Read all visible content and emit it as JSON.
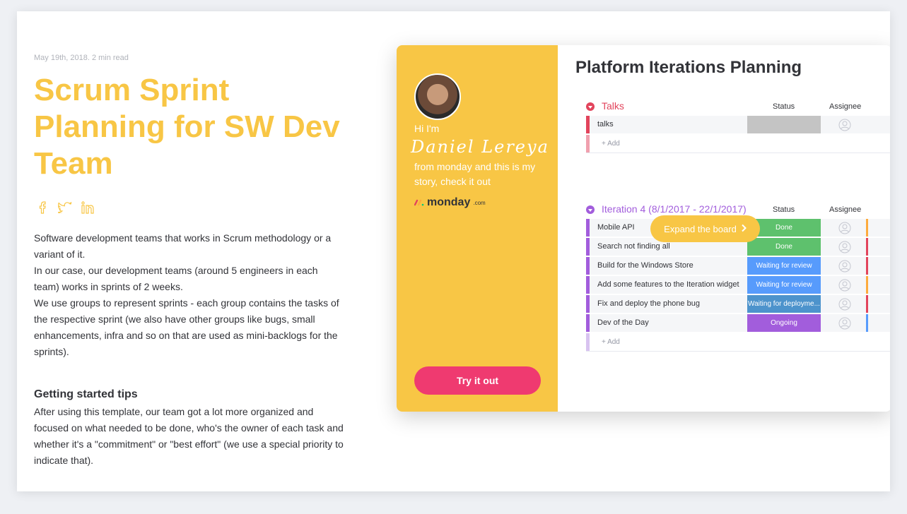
{
  "article": {
    "meta": "May 19th, 2018. 2 min read",
    "title": "Scrum Sprint Planning for SW Dev Team",
    "paragraphs": [
      "Software development teams that works in Scrum methodology or a variant of it.",
      "In our case, our development teams (around 5 engineers in each team) works in sprints of 2 weeks.",
      "We use groups to represent sprints - each group contains the tasks of the respective sprint (we also have other groups like bugs, small enhancements, infra and so on that are used as mini-backlogs for the sprints)."
    ],
    "subhead": "Getting started tips",
    "tips": "After using this template, our team got a lot more organized and focused on what needed to be done, who's the owner of each task and whether it's a \"commitment\" or \"best effort\" (we use a special priority to indicate that).",
    "social_icons": [
      "facebook-icon",
      "twitter-icon",
      "linkedin-icon"
    ],
    "accent_color": "#f8c645"
  },
  "profile": {
    "hi": "Hi I'm",
    "signature": "Daniel Lereya",
    "story": "from monday and this is my story, check it out",
    "logo_text": "monday",
    "logo_suffix": ".com",
    "cta": "Try it out",
    "cta_color": "#ef3a70"
  },
  "board": {
    "title": "Platform Iterations Planning",
    "expand_label": "Expand the board",
    "groups": [
      {
        "name": "Talks",
        "color": "#e2445c",
        "status_header": "Status",
        "assignee_header": "Assignee",
        "rows": [
          {
            "name": "talks",
            "status": "",
            "status_color": "#c4c4c4"
          }
        ],
        "add_label": "+ Add"
      },
      {
        "name": "Iteration 4 (8/1/2017 - 22/1/2017)",
        "color": "#a25ddc",
        "status_header": "Status",
        "assignee_header": "Assignee",
        "rows": [
          {
            "name": "Mobile API",
            "status": "Done",
            "status_color": "#00c875"
          },
          {
            "name": "Search not finding all",
            "status": "Done",
            "status_color": "#00c875"
          },
          {
            "name": "Build for the Windows Store",
            "status": "Waiting for review",
            "status_color": "#579bfc"
          },
          {
            "name": "Add some features to the Iteration widget",
            "status": "Waiting for review",
            "status_color": "#579bfc"
          },
          {
            "name": "Fix and deploy the phone bug",
            "status": "Waiting for deployme...",
            "status_color": "#4d93cc"
          },
          {
            "name": "Dev of the Day",
            "status": "Ongoing",
            "status_color": "#a25ddc"
          }
        ],
        "add_label": "+ Add"
      }
    ]
  }
}
